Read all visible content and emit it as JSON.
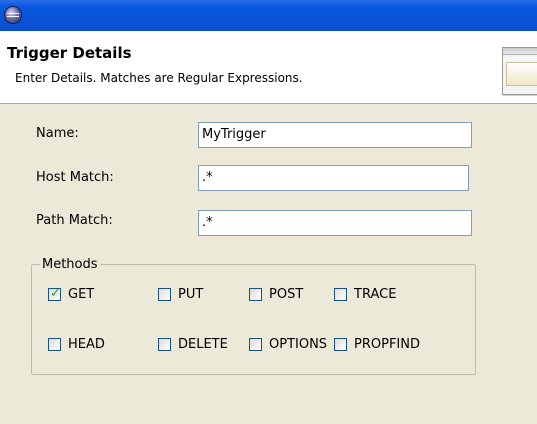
{
  "window": {
    "icon": "eclipse-icon"
  },
  "header": {
    "title": "Trigger Details",
    "description": "Enter Details. Matches are Regular Expressions.",
    "banner_icon": "wizard-banner-icon"
  },
  "form": {
    "name_label": "Name:",
    "name_value": "MyTrigger",
    "host_label": "Host Match:",
    "host_value": ".*",
    "path_label": "Path Match:",
    "path_value": ".*"
  },
  "methods": {
    "legend": "Methods",
    "items": [
      {
        "label": "GET",
        "checked": true
      },
      {
        "label": "PUT",
        "checked": false
      },
      {
        "label": "POST",
        "checked": false
      },
      {
        "label": "TRACE",
        "checked": false
      },
      {
        "label": "HEAD",
        "checked": false
      },
      {
        "label": "DELETE",
        "checked": false
      },
      {
        "label": "OPTIONS",
        "checked": false
      },
      {
        "label": "PROPFIND",
        "checked": false
      }
    ]
  },
  "colors": {
    "titlebar": "#0754d8",
    "dialog_bg": "#ece9d8",
    "checkmark": "#21a121"
  }
}
